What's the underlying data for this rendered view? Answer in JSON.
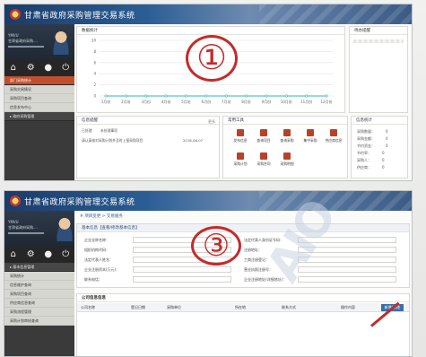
{
  "app_title": "甘肃省政府采购管理交易系统",
  "panel1": {
    "user_info": [
      "YMVU",
      "甘肃省政府采购...."
    ],
    "menu": [
      "部门采购统计",
      "采购交易情况",
      "采购项目查询",
      "信息发布中心",
      "▸ 政府采购管理"
    ],
    "boxes": {
      "chart_title": "数据统计",
      "right_title": "待办提醒",
      "notice_title": "信息提醒",
      "notice_more": "更多",
      "quick_title": "常用工具",
      "stats_title": "信息统计"
    },
    "chart_data": {
      "type": "line",
      "categories": [
        "1月份",
        "2月份",
        "3月份",
        "4月份",
        "5月份",
        "6月份",
        "7月份",
        "8月份",
        "9月份",
        "10月份",
        "11月份",
        "12月份"
      ],
      "values": [
        0,
        0,
        0,
        0,
        0,
        0,
        0,
        0,
        0,
        0,
        0,
        0
      ],
      "ylim": [
        0,
        10
      ],
      "yticks": [
        "0",
        "2",
        "4",
        "6",
        "8",
        "10"
      ],
      "grid": true,
      "line_color": "#2eb3c6"
    },
    "notice_items": [
      "已处理",
      "未处理事项",
      "请认真核对采购计划并及时上报采购项目",
      "2018-08-07"
    ],
    "quick_tools": [
      "发布信息",
      "查询项目",
      "查询采购",
      "集中采购",
      "供应商信息",
      "采购计划",
      "采购合同",
      "采购明细"
    ],
    "stats": [
      "采购数量：",
      "采购金额：",
      "节约资金：",
      "节约率：",
      "采购人：",
      "供应商："
    ],
    "stats_values": [
      "0",
      "0",
      "0",
      "0",
      "0",
      "0"
    ],
    "circle_label": "①"
  },
  "panel3": {
    "menu": [
      "▸ 基本信息管理",
      "采购统计",
      "信息维护查询",
      "采购项目查询",
      "供应商信息查询",
      "采购流程管理",
      "采购计划审核查询"
    ],
    "breadcrumb": "# 项目变更 > 交易服务",
    "section_title": "基本信息【查看/修改基本信息】",
    "fields_left": [
      {
        "label": "企业全称名称：",
        "value": "甘肃●●●●●●●有限公司"
      },
      {
        "label": "组织机构代码：",
        "value": "甘肃省兰州市"
      },
      {
        "label": "法定代表人姓名：",
        "value": ""
      },
      {
        "label": "企业注册资本(万元)：",
        "value": ""
      },
      {
        "label": "联系电话：",
        "value": ""
      }
    ],
    "fields_right": [
      {
        "label": "法定代表人身份证号码：",
        "value": "61●●●●●●"
      },
      {
        "label": "注册地址：",
        "value": "FG58●●●●"
      },
      {
        "label": "工商注册登记：",
        "value": "国家企业信用信息公示系统"
      },
      {
        "label": "营业执照注册号：",
        "value": "注册号码"
      },
      {
        "label": "企业注册地址(详细地址)：",
        "value": ""
      }
    ],
    "table_title": "公司信息信息",
    "table_headers": [
      "公司名称",
      "登记日期",
      "采购单位",
      "所在地",
      "联系方式",
      "操作内容"
    ],
    "add_button": "新增/修改",
    "circle_label": "③"
  }
}
